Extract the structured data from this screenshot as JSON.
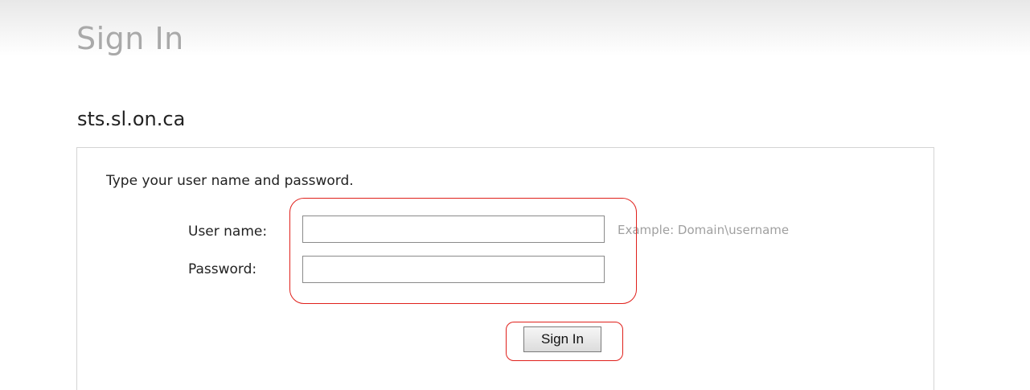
{
  "header": {
    "title": "Sign In"
  },
  "signin": {
    "domain": "sts.sl.on.ca",
    "instruction": "Type your user name and password.",
    "username_label": "User name:",
    "username_value": "",
    "username_hint": "Example: Domain\\username",
    "password_label": "Password:",
    "password_value": "",
    "submit_label": "Sign In"
  },
  "colors": {
    "annotation": "#e0201b",
    "title_gray": "#a9a9a9"
  }
}
